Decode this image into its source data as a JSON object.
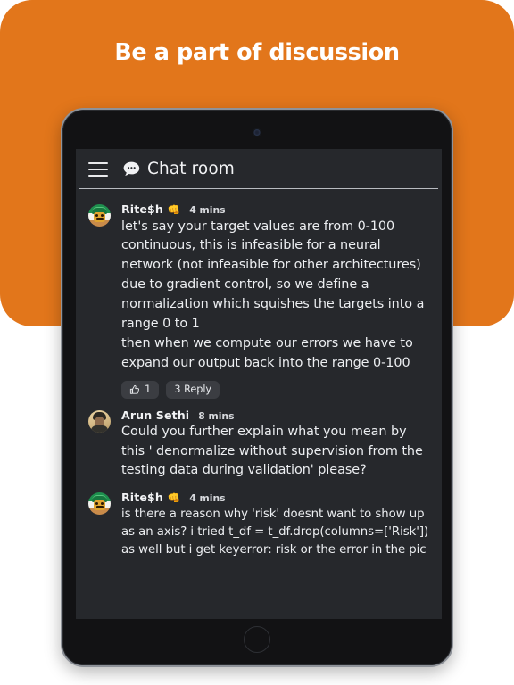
{
  "hero": {
    "title": "Be a part of discussion",
    "background_color": "#e2761b",
    "title_color": "#ffffff"
  },
  "device": {
    "type": "tablet",
    "frame_color": "#8e9299",
    "bezel_color": "#121214",
    "camera_icon": "camera-dot",
    "home_button_icon": "home-circle-icon"
  },
  "app": {
    "screen_background": "#26282c",
    "menu_icon": "hamburger-menu-icon",
    "chat_icon": "chat-bubble-icon",
    "title": "Chat room",
    "messages": [
      {
        "author": "Rite$h",
        "author_emoji": "👊",
        "timestamp": "4 mins",
        "avatar_icon": "avatar-ritesh",
        "text": "let's say your target values are from 0-100 continuous, this is infeasible for a neural network (not infeasible for other architectures) due to gradient control, so we define a normalization which squishes the targets into a range 0 to 1\nthen when we compute our errors we have to expand our output back into the range 0-100",
        "actions": {
          "like_icon": "thumbs-up-icon",
          "like_count": "1",
          "reply_label": "3 Reply"
        }
      },
      {
        "author": "Arun Sethi",
        "author_emoji": "",
        "timestamp": "8 mins",
        "avatar_icon": "avatar-arun",
        "text": "Could you further explain what  you mean by  this  ' denormalize without supervision from the testing data during validation' please?",
        "actions": null
      },
      {
        "author": "Rite$h",
        "author_emoji": "👊",
        "timestamp": "4 mins",
        "avatar_icon": "avatar-ritesh",
        "text": "is there a reason why 'risk' doesnt want to show up as an axis? i tried t_df = t_df.drop(columns=['Risk']) as well but i get keyerror: risk or the  error in the pic",
        "actions": null
      }
    ]
  }
}
